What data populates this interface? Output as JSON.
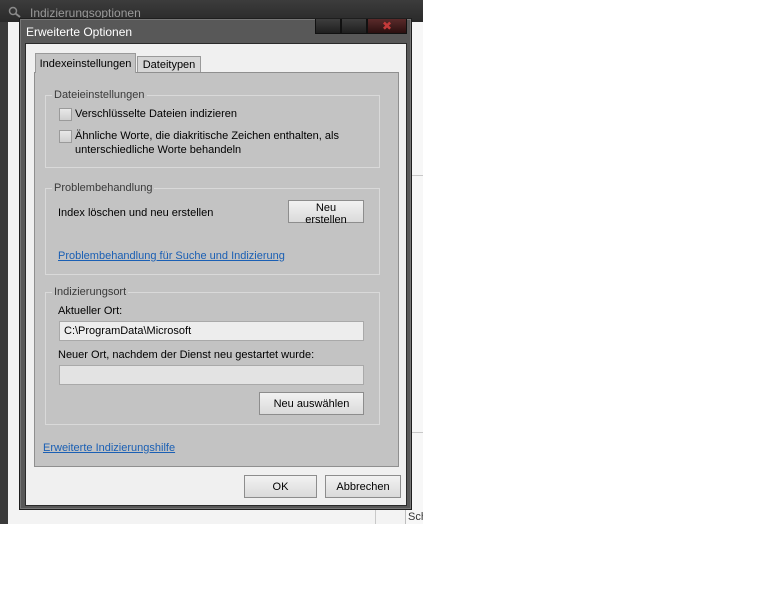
{
  "background_window": {
    "title": "Indizierungsoptionen",
    "partial_text": "Sch"
  },
  "dialog": {
    "title": "Erweiterte Optionen",
    "close_glyph": "✖"
  },
  "tabs": [
    {
      "label": "Indexeinstellungen",
      "selected": true
    },
    {
      "label": "Dateitypen",
      "selected": false
    }
  ],
  "file_settings": {
    "title": "Dateieinstellungen",
    "options": [
      {
        "label": "Verschlüsselte Dateien indizieren",
        "checked": false
      },
      {
        "label_line1": "Ähnliche Worte, die diakritische Zeichen enthalten, als",
        "label_line2": "unterschiedliche Worte behandeln",
        "checked": false
      }
    ]
  },
  "troubleshooting": {
    "title": "Problembehandlung",
    "rebuild_text": "Index löschen und neu erstellen",
    "rebuild_button": "Neu erstellen",
    "help_link": "Problembehandlung für Suche und Indizierung"
  },
  "index_location": {
    "title": "Indizierungsort",
    "current_label": "Aktueller Ort:",
    "current_value": "C:\\ProgramData\\Microsoft",
    "new_label": "Neuer Ort, nachdem der Dienst neu gestartet wurde:",
    "new_value": "",
    "select_button": "Neu auswählen"
  },
  "advanced_help_link": "Erweiterte Indizierungshilfe",
  "footer": {
    "ok": "OK",
    "cancel": "Abbrechen"
  }
}
